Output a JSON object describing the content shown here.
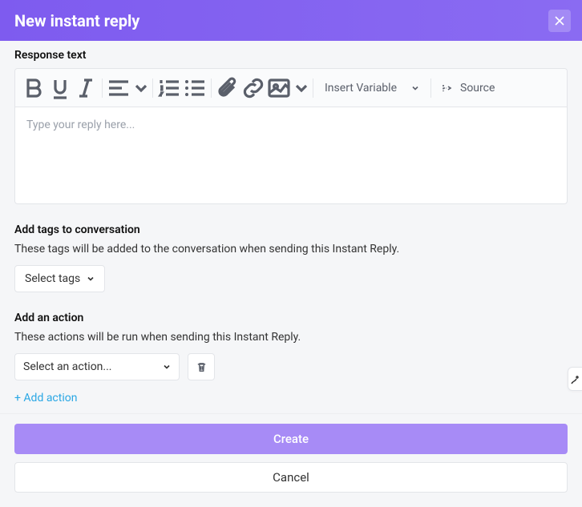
{
  "header": {
    "title": "New instant reply"
  },
  "response": {
    "label": "Response text",
    "placeholder": "Type your reply here...",
    "insert_variable": "Insert Variable",
    "source": "Source"
  },
  "tags": {
    "label": "Add tags to conversation",
    "desc": "These tags will be added to the conversation when sending this Instant Reply.",
    "select_label": "Select tags"
  },
  "actions": {
    "label": "Add an action",
    "desc": "These actions will be run when sending this Instant Reply.",
    "select_placeholder": "Select an action...",
    "add_label": "+ Add action"
  },
  "footer": {
    "create": "Create",
    "cancel": "Cancel"
  }
}
